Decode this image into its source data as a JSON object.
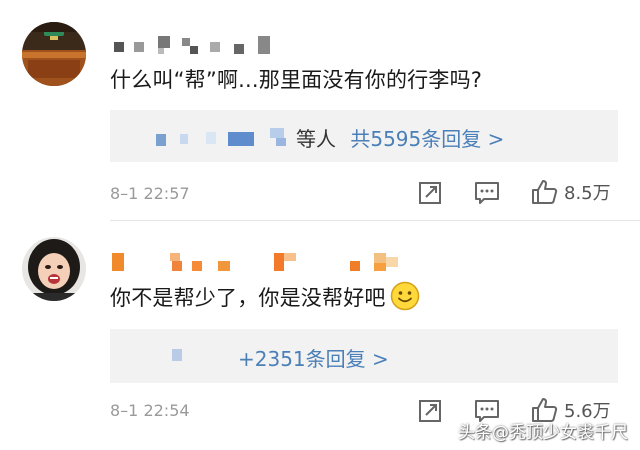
{
  "comments": [
    {
      "text": "什么叫“帮”啊...那里面没有你的行李吗?",
      "reply_people": "等人",
      "reply_count": "共5595条回复 >",
      "time": "8–1 22:57",
      "like_count": "8.5万"
    },
    {
      "text": "你不是帮少了，你是没帮好吧",
      "reply_count": "+2351条回复 >",
      "time": "8–1 22:54",
      "like_count": "5.6万"
    }
  ],
  "icons": {
    "share": "share-icon",
    "comment": "comment-icon",
    "like": "thumbs-up-icon",
    "emoji": "smile-emoji-icon"
  },
  "colors": {
    "link_blue": "#4a7fb8",
    "text": "#1a1a1a",
    "meta_gray": "#9a9a9a",
    "reply_bg": "#f2f2f2"
  },
  "watermark": "头条@秃顶少女裘千尺"
}
